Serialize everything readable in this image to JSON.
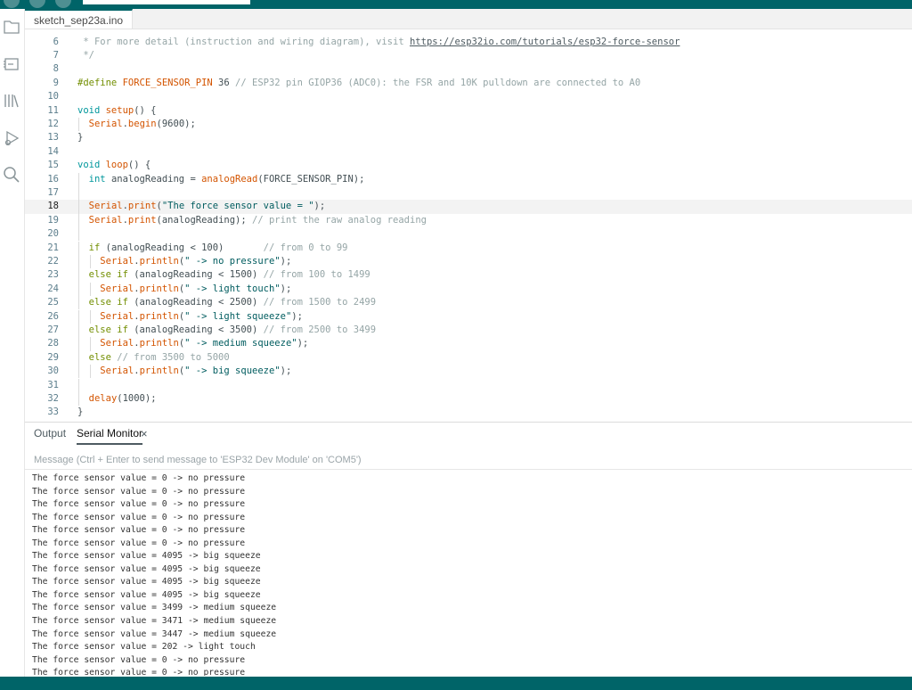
{
  "colors": {
    "accent": "#006468",
    "comment": "#95a5a6",
    "keyword": "#728e00",
    "type": "#00979c",
    "function": "#d35400",
    "string": "#005c5f"
  },
  "sidebar": {
    "icons": [
      "folder-icon",
      "board-icon",
      "library-icon",
      "debug-icon",
      "search-icon"
    ]
  },
  "file_tab": {
    "label": "sketch_sep23a.ino"
  },
  "editor": {
    "highlighted_line": 18,
    "lines": [
      {
        "n": "6",
        "tokens": [
          {
            "t": " * For more detail (instruction and wiring diagram), visit ",
            "c": "cm"
          },
          {
            "t": "https://esp32io.com/tutorials/esp32-force-sensor",
            "c": "url"
          }
        ]
      },
      {
        "n": "7",
        "tokens": [
          {
            "t": " */",
            "c": "cm"
          }
        ]
      },
      {
        "n": "8",
        "tokens": []
      },
      {
        "n": "9",
        "tokens": [
          {
            "t": "#define ",
            "c": "pp"
          },
          {
            "t": "FORCE_SENSOR_PIN",
            "c": "fn"
          },
          {
            "t": " 36 ",
            "c": "tx"
          },
          {
            "t": "// ESP32 pin GIOP36 (ADC0): the FSR and 10K pulldown are connected to A0",
            "c": "cm"
          }
        ]
      },
      {
        "n": "10",
        "tokens": []
      },
      {
        "n": "11",
        "tokens": [
          {
            "t": "void ",
            "c": "ty"
          },
          {
            "t": "setup",
            "c": "fn"
          },
          {
            "t": "() {",
            "c": "tx"
          }
        ]
      },
      {
        "n": "12",
        "guides": [
          1
        ],
        "tokens": [
          {
            "t": "  ",
            "c": "tx"
          },
          {
            "t": "Serial",
            "c": "fn"
          },
          {
            "t": ".",
            "c": "tx"
          },
          {
            "t": "begin",
            "c": "fn"
          },
          {
            "t": "(9600);",
            "c": "tx"
          }
        ]
      },
      {
        "n": "13",
        "tokens": [
          {
            "t": "}",
            "c": "tx"
          }
        ]
      },
      {
        "n": "14",
        "tokens": []
      },
      {
        "n": "15",
        "tokens": [
          {
            "t": "void ",
            "c": "ty"
          },
          {
            "t": "loop",
            "c": "fn"
          },
          {
            "t": "() {",
            "c": "tx"
          }
        ]
      },
      {
        "n": "16",
        "guides": [
          1
        ],
        "tokens": [
          {
            "t": "  ",
            "c": "tx"
          },
          {
            "t": "int ",
            "c": "ty"
          },
          {
            "t": "analogReading = ",
            "c": "tx"
          },
          {
            "t": "analogRead",
            "c": "fn"
          },
          {
            "t": "(FORCE_SENSOR_PIN);",
            "c": "tx"
          }
        ]
      },
      {
        "n": "17",
        "guides": [
          1
        ],
        "tokens": []
      },
      {
        "n": "18",
        "guides": [
          1
        ],
        "tokens": [
          {
            "t": "  ",
            "c": "tx"
          },
          {
            "t": "Serial",
            "c": "fn"
          },
          {
            "t": ".",
            "c": "tx"
          },
          {
            "t": "print",
            "c": "fn"
          },
          {
            "t": "(",
            "c": "tx"
          },
          {
            "t": "\"The force sensor value = \"",
            "c": "st"
          },
          {
            "t": ");",
            "c": "tx"
          }
        ]
      },
      {
        "n": "19",
        "guides": [
          1
        ],
        "tokens": [
          {
            "t": "  ",
            "c": "tx"
          },
          {
            "t": "Serial",
            "c": "fn"
          },
          {
            "t": ".",
            "c": "tx"
          },
          {
            "t": "print",
            "c": "fn"
          },
          {
            "t": "(analogReading); ",
            "c": "tx"
          },
          {
            "t": "// print the raw analog reading",
            "c": "cm"
          }
        ]
      },
      {
        "n": "20",
        "guides": [
          1
        ],
        "tokens": []
      },
      {
        "n": "21",
        "guides": [
          1
        ],
        "tokens": [
          {
            "t": "  ",
            "c": "tx"
          },
          {
            "t": "if ",
            "c": "kw"
          },
          {
            "t": "(analogReading < 100)       ",
            "c": "tx"
          },
          {
            "t": "// from 0 to 99",
            "c": "cm"
          }
        ]
      },
      {
        "n": "22",
        "guides": [
          1,
          2
        ],
        "tokens": [
          {
            "t": "    ",
            "c": "tx"
          },
          {
            "t": "Serial",
            "c": "fn"
          },
          {
            "t": ".",
            "c": "tx"
          },
          {
            "t": "println",
            "c": "fn"
          },
          {
            "t": "(",
            "c": "tx"
          },
          {
            "t": "\" -> no pressure\"",
            "c": "st"
          },
          {
            "t": ");",
            "c": "tx"
          }
        ]
      },
      {
        "n": "23",
        "guides": [
          1
        ],
        "tokens": [
          {
            "t": "  ",
            "c": "tx"
          },
          {
            "t": "else if ",
            "c": "kw"
          },
          {
            "t": "(analogReading < 1500) ",
            "c": "tx"
          },
          {
            "t": "// from 100 to 1499",
            "c": "cm"
          }
        ]
      },
      {
        "n": "24",
        "guides": [
          1,
          2
        ],
        "tokens": [
          {
            "t": "    ",
            "c": "tx"
          },
          {
            "t": "Serial",
            "c": "fn"
          },
          {
            "t": ".",
            "c": "tx"
          },
          {
            "t": "println",
            "c": "fn"
          },
          {
            "t": "(",
            "c": "tx"
          },
          {
            "t": "\" -> light touch\"",
            "c": "st"
          },
          {
            "t": ");",
            "c": "tx"
          }
        ]
      },
      {
        "n": "25",
        "guides": [
          1
        ],
        "tokens": [
          {
            "t": "  ",
            "c": "tx"
          },
          {
            "t": "else if ",
            "c": "kw"
          },
          {
            "t": "(analogReading < 2500) ",
            "c": "tx"
          },
          {
            "t": "// from 1500 to 2499",
            "c": "cm"
          }
        ]
      },
      {
        "n": "26",
        "guides": [
          1,
          2
        ],
        "tokens": [
          {
            "t": "    ",
            "c": "tx"
          },
          {
            "t": "Serial",
            "c": "fn"
          },
          {
            "t": ".",
            "c": "tx"
          },
          {
            "t": "println",
            "c": "fn"
          },
          {
            "t": "(",
            "c": "tx"
          },
          {
            "t": "\" -> light squeeze\"",
            "c": "st"
          },
          {
            "t": ");",
            "c": "tx"
          }
        ]
      },
      {
        "n": "27",
        "guides": [
          1
        ],
        "tokens": [
          {
            "t": "  ",
            "c": "tx"
          },
          {
            "t": "else if ",
            "c": "kw"
          },
          {
            "t": "(analogReading < 3500) ",
            "c": "tx"
          },
          {
            "t": "// from 2500 to 3499",
            "c": "cm"
          }
        ]
      },
      {
        "n": "28",
        "guides": [
          1,
          2
        ],
        "tokens": [
          {
            "t": "    ",
            "c": "tx"
          },
          {
            "t": "Serial",
            "c": "fn"
          },
          {
            "t": ".",
            "c": "tx"
          },
          {
            "t": "println",
            "c": "fn"
          },
          {
            "t": "(",
            "c": "tx"
          },
          {
            "t": "\" -> medium squeeze\"",
            "c": "st"
          },
          {
            "t": ");",
            "c": "tx"
          }
        ]
      },
      {
        "n": "29",
        "guides": [
          1
        ],
        "tokens": [
          {
            "t": "  ",
            "c": "tx"
          },
          {
            "t": "else ",
            "c": "kw"
          },
          {
            "t": "// from 3500 to 5000",
            "c": "cm"
          }
        ]
      },
      {
        "n": "30",
        "guides": [
          1,
          2
        ],
        "tokens": [
          {
            "t": "    ",
            "c": "tx"
          },
          {
            "t": "Serial",
            "c": "fn"
          },
          {
            "t": ".",
            "c": "tx"
          },
          {
            "t": "println",
            "c": "fn"
          },
          {
            "t": "(",
            "c": "tx"
          },
          {
            "t": "\" -> big squeeze\"",
            "c": "st"
          },
          {
            "t": ");",
            "c": "tx"
          }
        ]
      },
      {
        "n": "31",
        "guides": [
          1
        ],
        "tokens": []
      },
      {
        "n": "32",
        "guides": [
          1
        ],
        "tokens": [
          {
            "t": "  ",
            "c": "tx"
          },
          {
            "t": "delay",
            "c": "fn"
          },
          {
            "t": "(1000);",
            "c": "tx"
          }
        ]
      },
      {
        "n": "33",
        "tokens": [
          {
            "t": "}",
            "c": "tx"
          }
        ]
      }
    ]
  },
  "panel": {
    "tabs": [
      {
        "label": "Output",
        "active": false
      },
      {
        "label": "Serial Monitor",
        "active": true,
        "closable": true
      }
    ],
    "close_glyph": "×",
    "message_placeholder": "Message (Ctrl + Enter to send message to 'ESP32 Dev Module' on 'COM5')",
    "log": [
      "The force sensor value = 0 -> no pressure",
      "The force sensor value = 0 -> no pressure",
      "The force sensor value = 0 -> no pressure",
      "The force sensor value = 0 -> no pressure",
      "The force sensor value = 0 -> no pressure",
      "The force sensor value = 0 -> no pressure",
      "The force sensor value = 4095 -> big squeeze",
      "The force sensor value = 4095 -> big squeeze",
      "The force sensor value = 4095 -> big squeeze",
      "The force sensor value = 4095 -> big squeeze",
      "The force sensor value = 3499 -> medium squeeze",
      "The force sensor value = 3471 -> medium squeeze",
      "The force sensor value = 3447 -> medium squeeze",
      "The force sensor value = 202 -> light touch",
      "The force sensor value = 0 -> no pressure",
      "The force sensor value = 0 -> no pressure"
    ]
  }
}
